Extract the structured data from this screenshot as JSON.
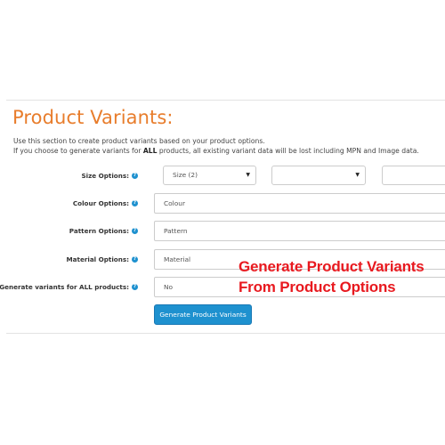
{
  "section": {
    "title": "Product Variants:",
    "desc_line1": "Use this section to create product variants based on your product options.",
    "desc_line2_pre": "If you choose to generate variants for ",
    "desc_line2_bold": "ALL",
    "desc_line2_post": " products, all existing variant data will be lost including MPN and Image data."
  },
  "form": {
    "size_label": "Size Options:",
    "size_select_1": "Size (2)",
    "size_select_2": "",
    "size_select_3": "",
    "colour_label": "Colour Options:",
    "colour_value": "Colour",
    "pattern_label": "Pattern Options:",
    "pattern_value": "Pattern",
    "material_label": "Material Options:",
    "material_value": "Material",
    "generate_all_label": "Generate variants for ALL products:",
    "generate_all_value": "No",
    "help_glyph": "?",
    "caret_glyph": "▼",
    "generate_button": "Generate Product Variants"
  },
  "overlay": {
    "line1": "Generate Product Variants",
    "line2": "From Product Options"
  },
  "colors": {
    "title_orange": "#e87d2c",
    "button_blue": "#1e91cf",
    "overlay_red": "#e8191f"
  },
  "icons": {
    "help": "help-circle-icon",
    "caret": "caret-down-icon"
  }
}
